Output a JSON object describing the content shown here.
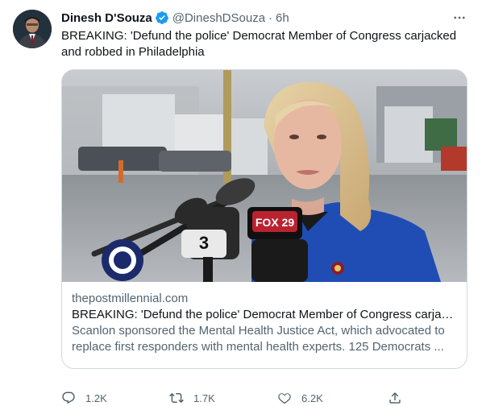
{
  "tweet": {
    "display_name": "Dinesh D'Souza",
    "handle": "@DineshDSouza",
    "separator": "·",
    "time": "6h",
    "text": "BREAKING: 'Defund the police' Democrat Member of Congress carjacked and robbed in Philadelphia",
    "verified_icon": "verified-badge-icon",
    "more_icon": "more-horizontal-icon"
  },
  "card": {
    "domain": "thepostmillennial.com",
    "title": "BREAKING: 'Defund the police' Democrat Member of Congress carjac...",
    "description": "Scanlon sponsored the Mental Health Justice Act, which advocated to replace first responders with mental health experts. 125 Democrats ...",
    "image": {
      "mic_logo_left": "3",
      "mic_logo_right": "FOX 29"
    }
  },
  "actions": {
    "reply_count": "1.2K",
    "retweet_count": "1.7K",
    "like_count": "6.2K",
    "icons": [
      "reply-icon",
      "retweet-icon",
      "like-icon",
      "share-icon"
    ]
  },
  "colors": {
    "text_primary": "#0f1419",
    "text_secondary": "#536471",
    "verified_blue": "#1d9bf0",
    "border": "#cfd9de"
  }
}
